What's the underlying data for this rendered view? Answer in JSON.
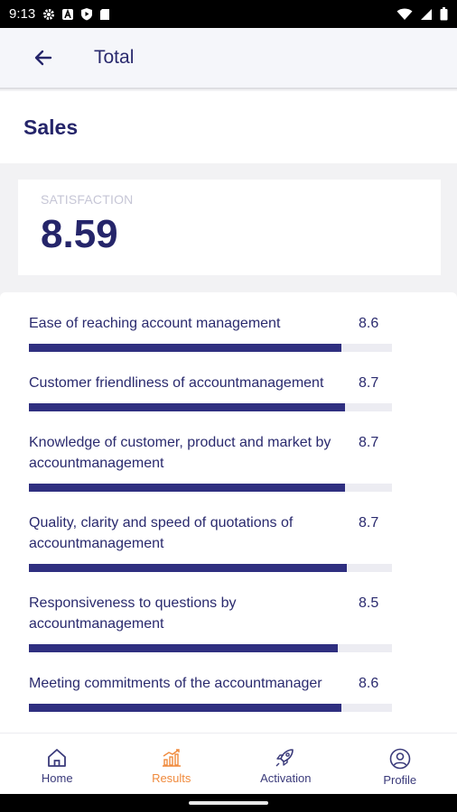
{
  "status_bar": {
    "time": "9:13"
  },
  "app_bar": {
    "title": "Total"
  },
  "section": {
    "title": "Sales"
  },
  "satisfaction": {
    "label": "SATISFACTION",
    "value": "8.59"
  },
  "metrics": [
    {
      "label": "Ease of reaching account management",
      "value": "8.6",
      "fill_fraction": 0.86
    },
    {
      "label": "Customer friendliness of accountmanagement",
      "value": "8.7",
      "fill_fraction": 0.87
    },
    {
      "label": "Knowledge of customer, product and market by accountmanagement",
      "value": "8.7",
      "fill_fraction": 0.87
    },
    {
      "label": "Quality, clarity and speed of quotations of accountmanagement",
      "value": "8.7",
      "fill_fraction": 0.875
    },
    {
      "label": "Responsiveness to questions by accountmanagement",
      "value": "8.5",
      "fill_fraction": 0.85
    },
    {
      "label": "Meeting commitments of the accountmanager",
      "value": "8.6",
      "fill_fraction": 0.86
    }
  ],
  "bottom_nav": {
    "items": [
      {
        "label": "Home",
        "icon": "home-icon",
        "active": false
      },
      {
        "label": "Results",
        "icon": "results-chart-icon",
        "active": true
      },
      {
        "label": "Activation",
        "icon": "rocket-icon",
        "active": false
      },
      {
        "label": "Profile",
        "icon": "profile-icon",
        "active": false
      }
    ]
  },
  "colors": {
    "primary": "#25256a",
    "bar": "#2f2f80",
    "accent": "#f08a3c",
    "track": "#ececf2"
  }
}
